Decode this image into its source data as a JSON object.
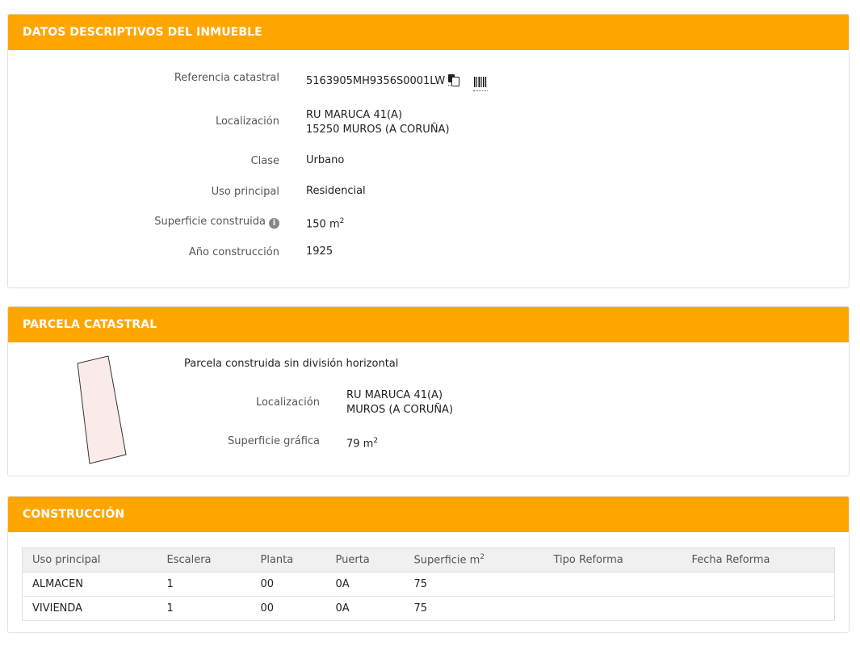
{
  "colors": {
    "header_bg": "#ffa500",
    "header_text": "#ffffff"
  },
  "datos": {
    "title": "DATOS DESCRIPTIVOS DEL INMUEBLE",
    "referencia_label": "Referencia catastral",
    "referencia_value": "5163905MH9356S0001LW",
    "localizacion_label": "Localización",
    "localizacion_line1": "RU MARUCA 41(A)",
    "localizacion_line2": "15250 MUROS (A CORUÑA)",
    "clase_label": "Clase",
    "clase_value": "Urbano",
    "uso_label": "Uso principal",
    "uso_value": "Residencial",
    "superficie_label": "Superficie construida",
    "superficie_value": "150 m",
    "superficie_unit_exp": "2",
    "anio_label": "Año construcción",
    "anio_value": "1925"
  },
  "parcela": {
    "title": "PARCELA CATASTRAL",
    "descripcion": "Parcela construida sin división horizontal",
    "localizacion_label": "Localización",
    "localizacion_line1": "RU MARUCA 41(A)",
    "localizacion_line2": "MUROS (A CORUÑA)",
    "superficie_label": "Superficie gráfica",
    "superficie_value": "79 m",
    "superficie_unit_exp": "2"
  },
  "construccion": {
    "title": "CONSTRUCCIÓN",
    "headers": [
      "Uso principal",
      "Escalera",
      "Planta",
      "Puerta",
      "Superficie m",
      "Tipo Reforma",
      "Fecha Reforma"
    ],
    "superficie_header_exp": "2",
    "rows": [
      [
        "ALMACEN",
        "1",
        "00",
        "0A",
        "75",
        "",
        ""
      ],
      [
        "VIVIENDA",
        "1",
        "00",
        "0A",
        "75",
        "",
        ""
      ]
    ]
  }
}
